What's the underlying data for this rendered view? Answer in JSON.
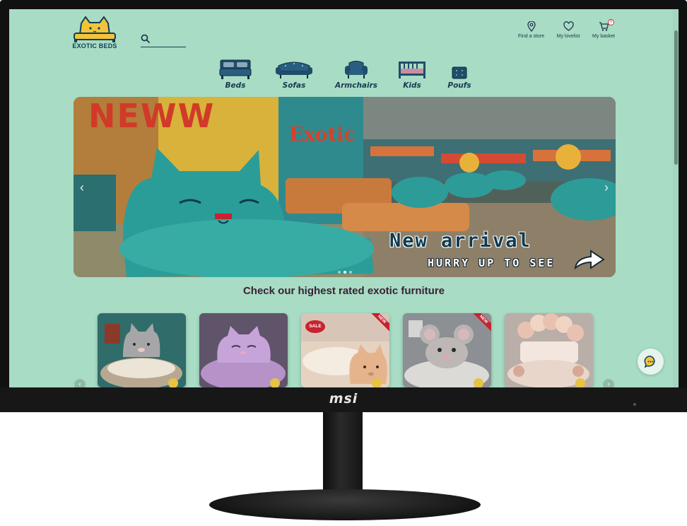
{
  "monitor": {
    "brand": "msi"
  },
  "header": {
    "logo_text": "EXOTIC BEDS",
    "search_placeholder": "",
    "links": {
      "find_store": "Find a store",
      "lovelist": "My lovelist",
      "basket": "My basket",
      "basket_count": "0"
    }
  },
  "categories": [
    {
      "label": "Beds",
      "icon": "bed-icon"
    },
    {
      "label": "Sofas",
      "icon": "sofa-icon"
    },
    {
      "label": "Armchairs",
      "icon": "armchair-icon"
    },
    {
      "label": "Kids",
      "icon": "crib-icon"
    },
    {
      "label": "Poufs",
      "icon": "pouf-icon"
    }
  ],
  "hero": {
    "sign_big": "NEWW",
    "sign_store": "Exotic",
    "title": "New arrival",
    "subtitle": "HURRY UP TO SEE",
    "slide_count": 3,
    "active_slide": 1
  },
  "section_title": "Check our highest rated exotic furniture",
  "products": [
    {
      "badge": "",
      "tag": ""
    },
    {
      "badge": "",
      "tag": ""
    },
    {
      "badge": "NEW",
      "tag": "SALE"
    },
    {
      "badge": "NEW",
      "tag": ""
    },
    {
      "badge": "",
      "tag": ""
    }
  ],
  "colors": {
    "page_bg": "#a8dcc4",
    "navy": "#1a3a52",
    "accent_red": "#c8222f",
    "heading": "#3a2036"
  }
}
